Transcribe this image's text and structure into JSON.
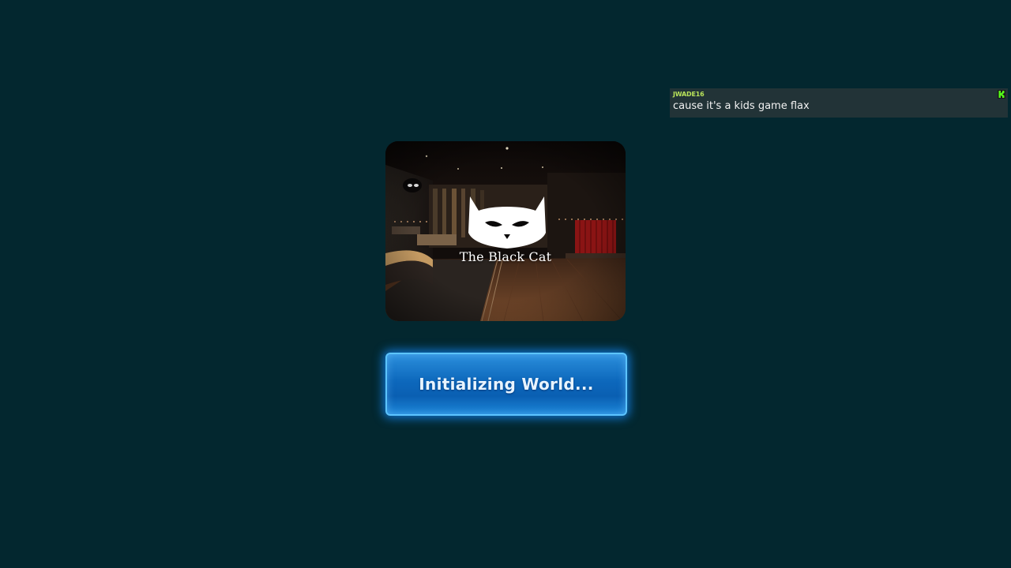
{
  "chat": {
    "username": "JWADE16",
    "message": "cause it's a kids game flax",
    "platform_icon": "kick-icon",
    "username_color": "#b9e25a"
  },
  "world": {
    "name": "The Black Cat",
    "logo_icon": "cat-mask-icon"
  },
  "status": {
    "label": "Initializing World...",
    "accent_color": "#148cff"
  },
  "colors": {
    "background": "#03272f"
  }
}
